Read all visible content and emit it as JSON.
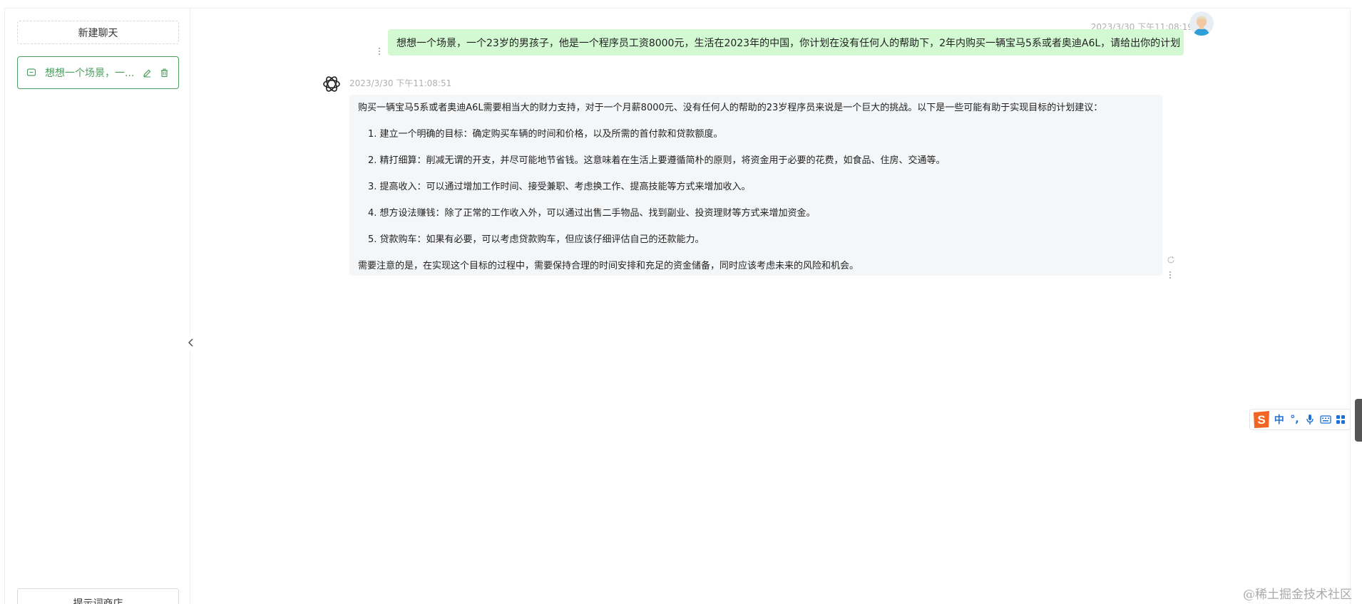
{
  "sidebar": {
    "new_chat_label": "新建聊天",
    "history": [
      {
        "title": "想想一个场景，一...",
        "active": true
      }
    ],
    "prompt_store_label": "提示词商店"
  },
  "conversation": {
    "user_message": {
      "time": "2023/3/30 下午11:08:19",
      "text": "想想一个场景，一个23岁的男孩子，他是一个程序员工资8000元，生活在2023年的中国，你计划在没有任何人的帮助下，2年内购买一辆宝马5系或者奥迪A6L，请给出你的计划"
    },
    "bot_message": {
      "time": "2023/3/30 下午11:08:51",
      "intro": "购买一辆宝马5系或者奥迪A6L需要相当大的财力支持，对于一个月薪8000元、没有任何人的帮助的23岁程序员来说是一个巨大的挑战。以下是一些可能有助于实现目标的计划建议：",
      "items": [
        "1. 建立一个明确的目标：确定购买车辆的时间和价格，以及所需的首付款和贷款额度。",
        "2. 精打细算：削减无谓的开支，并尽可能地节省钱。这意味着在生活上要遵循简朴的原则，将资金用于必要的花费，如食品、住房、交通等。",
        "3. 提高收入：可以通过增加工作时间、接受兼职、考虑换工作、提高技能等方式来增加收入。",
        "4. 想方设法赚钱：除了正常的工作收入外，可以通过出售二手物品、找到副业、投资理财等方式来增加资金。",
        "5. 贷款购车：如果有必要，可以考虑贷款购车，但应该仔细评估自己的还款能力。"
      ],
      "outro": "需要注意的是，在实现这个目标的过程中，需要保持合理的时间安排和充足的资金储备，同时应该考虑未来的风险和机会。"
    }
  },
  "ime": {
    "logo": "S",
    "mode": "中",
    "punct": "°,"
  },
  "watermark": "@稀土掘金技术社区",
  "colors": {
    "accent": "#4b9e5f",
    "user_bubble": "#d2f9d1",
    "bot_bubble": "#f4f6f8",
    "ime_blue": "#1e6fd9",
    "ime_logo": "#f26522"
  },
  "icons": {
    "history_item": "chat-bubble-icon",
    "edit": "edit-icon",
    "delete": "trash-icon",
    "collapse": "chevron-left-icon",
    "user_avatar": "user-avatar-icon",
    "bot_avatar": "openai-logo-icon",
    "refresh": "refresh-icon",
    "more": "more-vertical-icon",
    "ime_voice": "microphone-icon",
    "ime_keyboard": "keyboard-icon",
    "ime_menu": "grid-icon"
  }
}
